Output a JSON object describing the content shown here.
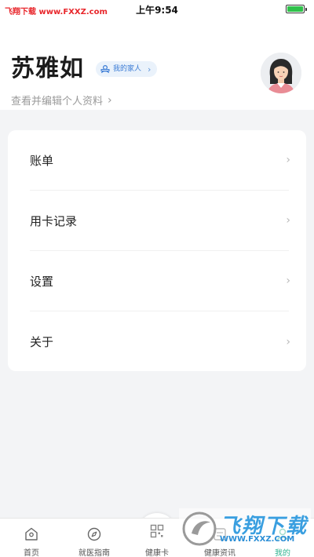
{
  "status_bar": {
    "watermark": "飞翔下载 www.FXXZ.com",
    "time": "上午9:54"
  },
  "header": {
    "user_name": "苏雅如",
    "family_badge": "我的家人",
    "edit_profile": "查看并编辑个人资料"
  },
  "menu": [
    {
      "label": "账单"
    },
    {
      "label": "用卡记录"
    },
    {
      "label": "设置"
    },
    {
      "label": "关于"
    }
  ],
  "tabbar": {
    "tabs": [
      {
        "label": "首页",
        "icon": "home-icon"
      },
      {
        "label": "就医指南",
        "icon": "compass-icon"
      },
      {
        "label": "健康卡",
        "icon": "qr-code-icon"
      },
      {
        "label": "健康资讯",
        "icon": "news-icon"
      },
      {
        "label": "我的",
        "icon": "profile-icon"
      }
    ],
    "active_index": 4
  },
  "watermark": {
    "text": "飞翔下载",
    "url": "WWW.FXXZ.COM"
  },
  "colors": {
    "accent": "#2fb38f",
    "badge_bg": "#eaf2fb",
    "badge_text": "#3a7bd5",
    "background": "#f3f4f6"
  }
}
